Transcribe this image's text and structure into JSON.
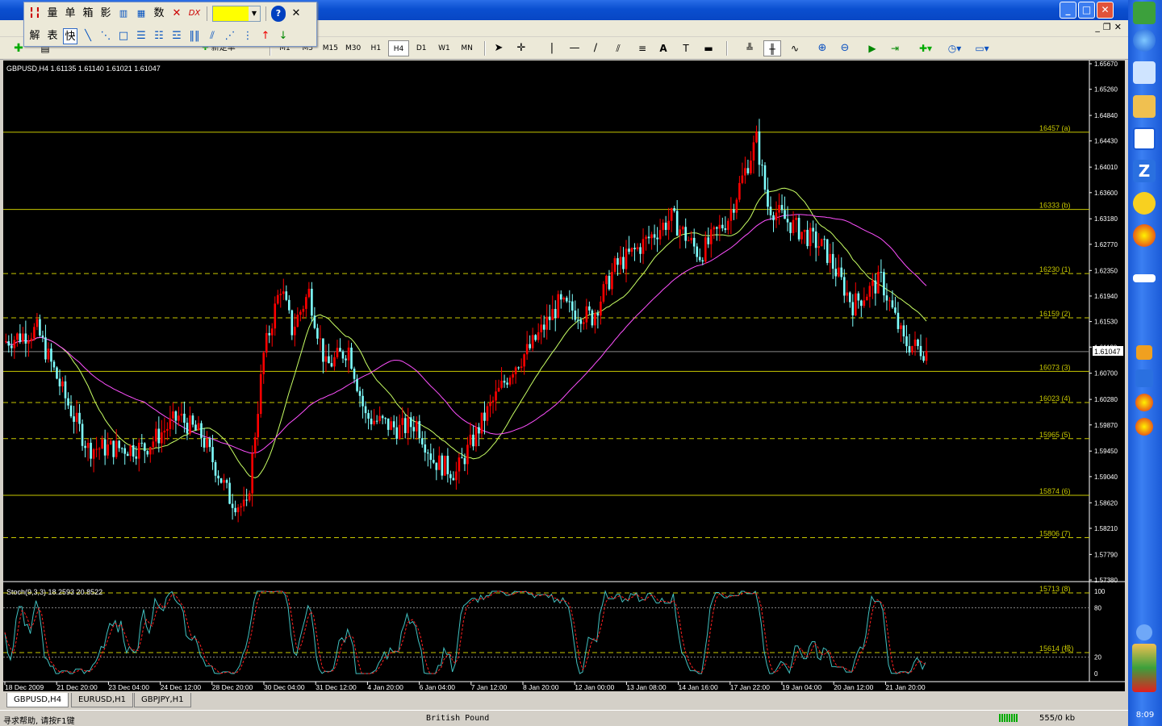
{
  "window": {
    "min": "_",
    "max": "□",
    "close": "✕"
  },
  "float_toolbar": {
    "row1": [
      "量",
      "单",
      "箱",
      "影",
      "数"
    ],
    "row2": [
      "解",
      "表",
      "快"
    ],
    "help": "?",
    "close": "✕"
  },
  "toolbar": {
    "new_order_label": "新定单",
    "timeframes": [
      "M1",
      "M5",
      "M15",
      "M30",
      "H1",
      "H4",
      "D1",
      "W1",
      "MN"
    ],
    "active_timeframe": "H4"
  },
  "chart": {
    "header": "GBPUSD,H4  1.61135 1.61140 1.61021 1.61047",
    "current_price": "1.61047",
    "price_scale": [
      "1.65670",
      "1.65260",
      "1.64840",
      "1.64430",
      "1.64010",
      "1.63600",
      "1.63180",
      "1.62770",
      "1.62350",
      "1.61940",
      "1.61530",
      "1.61120",
      "1.60700",
      "1.60280",
      "1.59870",
      "1.59450",
      "1.59040",
      "1.58620",
      "1.58210",
      "1.57790",
      "1.57380"
    ],
    "fibo_labels": [
      "16457 (a)",
      "16333 (b)",
      "16230 (1)",
      "16159 (2)",
      "16073 (3)",
      "16023 (4)",
      "15965 (5)",
      "15874 (6)",
      "15806 (7)",
      "15713 (8)",
      "15614 (极)"
    ],
    "time_labels": [
      "18 Dec 2009",
      "21 Dec 20:00",
      "23 Dec 04:00",
      "24 Dec 12:00",
      "28 Dec 20:00",
      "30 Dec 04:00",
      "31 Dec 12:00",
      "4 Jan 20:00",
      "6 Jan 04:00",
      "7 Jan 12:00",
      "8 Jan 20:00",
      "12 Jan 00:00",
      "13 Jan 08:00",
      "14 Jan 16:00",
      "17 Jan 22:00",
      "19 Jan 04:00",
      "20 Jan 12:00",
      "21 Jan 20:00"
    ],
    "stoch_header": "Stoch(9,3,3) 18.2593 20.8522",
    "stoch_scale": [
      "100",
      "80",
      "20",
      "0"
    ]
  },
  "tabs": [
    "GBPUSD,H4",
    "EURUSD,H1",
    "GBPJPY,H1"
  ],
  "active_tab": "GBPUSD,H4",
  "status": {
    "help": "寻求帮助, 请按F1键",
    "profile": "British Pound",
    "traffic": "555/0 kb"
  },
  "clock": "8:09",
  "colors": {
    "bull": "#ff0000",
    "bear": "#7fffff",
    "fibo": "#c8c800",
    "ma_fast": "#c8ff64",
    "ma_slow": "#ff50ff",
    "stoch_main": "#40c0c0",
    "stoch_signal": "#ff2020"
  }
}
